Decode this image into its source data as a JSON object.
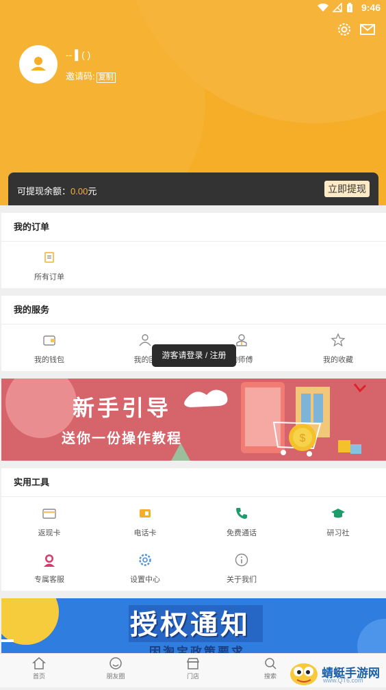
{
  "status_bar": {
    "time": "9:46"
  },
  "profile": {
    "nickname": "-- ▌( )",
    "invite_label": "邀请码:",
    "copy_label": "复制"
  },
  "balance": {
    "label": "可提现余额：",
    "amount": "0.00",
    "unit": "元",
    "withdraw_label": "立即提现"
  },
  "orders": {
    "title": "我的订单",
    "items": [
      {
        "label": "所有订单",
        "icon": "order-list-icon"
      }
    ]
  },
  "services": {
    "title": "我的服务",
    "items": [
      {
        "label": "我的钱包",
        "icon": "wallet-icon"
      },
      {
        "label": "我的团",
        "icon": "team-icon"
      },
      {
        "label": "的师傅",
        "icon": "mentor-icon"
      },
      {
        "label": "我的收藏",
        "icon": "star-icon"
      }
    ]
  },
  "toast": {
    "text": "游客请登录 / 注册"
  },
  "banner_guide": {
    "title": "新手引导",
    "subtitle": "送你一份操作教程"
  },
  "tools": {
    "title": "实用工具",
    "items": [
      {
        "label": "返现卡",
        "icon": "cashback-card-icon"
      },
      {
        "label": "电话卡",
        "icon": "sim-card-icon"
      },
      {
        "label": "免费通话",
        "icon": "phone-icon"
      },
      {
        "label": "研习社",
        "icon": "graduation-cap-icon"
      },
      {
        "label": "专属客服",
        "icon": "customer-service-icon"
      },
      {
        "label": "设置中心",
        "icon": "settings-icon"
      },
      {
        "label": "关于我们",
        "icon": "info-icon"
      }
    ]
  },
  "banner_notice": {
    "title": "授权通知",
    "subtitle": "因淘宝政策要求"
  },
  "bottom_nav": {
    "items": [
      {
        "label": "首页",
        "icon": "home-icon"
      },
      {
        "label": "朋友圈",
        "icon": "moments-icon"
      },
      {
        "label": "门店",
        "icon": "store-icon"
      },
      {
        "label": "搜索",
        "icon": "search-icon"
      }
    ]
  },
  "watermark": {
    "text": "蜻蜓手游网",
    "url": "www.QT6.com"
  },
  "colors": {
    "brand": "#f6ae28",
    "dark_bar": "#333333",
    "amount": "#f6b13a"
  }
}
